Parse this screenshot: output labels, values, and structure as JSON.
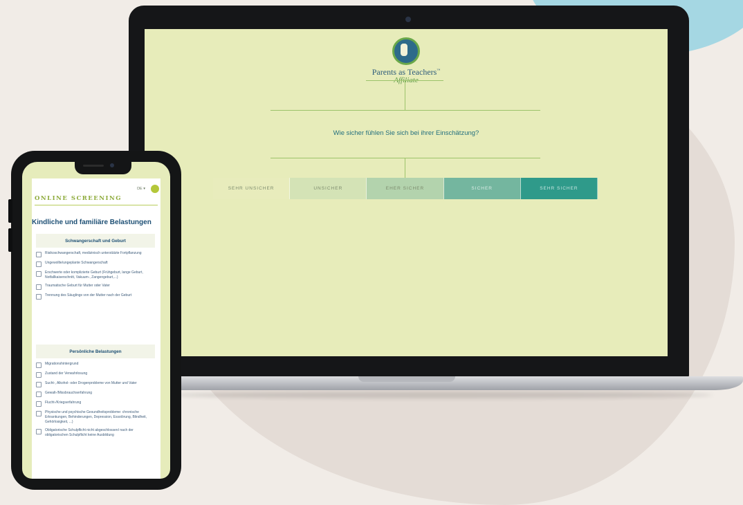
{
  "laptop": {
    "logo_text": "Parents as Teachers",
    "logo_tm": "™",
    "logo_script": "Affiliate",
    "question": "Wie sicher fühlen Sie sich bei ihrer Einschätzung?",
    "scale_options": [
      {
        "label": "SEHR UNSICHER",
        "bg": "#e8ecbc"
      },
      {
        "label": "UNSICHER",
        "bg": "#d4e3b6"
      },
      {
        "label": "EHER SICHER",
        "bg": "#b3d3ad"
      },
      {
        "label": "SICHER",
        "bg": "#74b69f"
      },
      {
        "label": "SEHR SICHER",
        "bg": "#2f9a8a"
      }
    ]
  },
  "phone": {
    "lang": "DE ▾",
    "screening_title": "ONLINE SCREENING",
    "main_heading": "Kindliche und familiäre Belastungen",
    "sections": [
      {
        "title": "Schwangerschaft und Geburt",
        "items": [
          "Risikoschwangerschaft, medizinisch unterstützte Fortpflanzung",
          "Ungewollte/ungeplante Schwangerschaft",
          "Erschwerte oder komplizierte Geburt (Frühgeburt, lange Geburt, Notfallkaiserschnitt, Vakuum-, Zangengeburt,...)",
          "Traumatische Geburt für Mutter oder Vater",
          "Trennung des Säuglings von der Mutter nach der Geburt"
        ]
      },
      {
        "title": "Persönliche Belastungen",
        "items": [
          "Migrationshintergrund",
          "Zustand der Verwahrlosung",
          "Sucht-, Alkohol- oder Drogenprobleme von Mutter und Vater",
          "Gewalt-/Missbrauchserfahrung",
          "Flucht-/Kriegserfahrung",
          "Physische und psychische Gesundheitsprobleme: chronische Erkrankungen, Behinderungen, Depression, Essstörung, Blindheit, Gehörlosigkeit, ...)",
          "Obligatorische Schulpflicht nicht abgeschlossen/ nach der obligatorischen Schulpflicht keine Ausbildung"
        ]
      }
    ]
  }
}
